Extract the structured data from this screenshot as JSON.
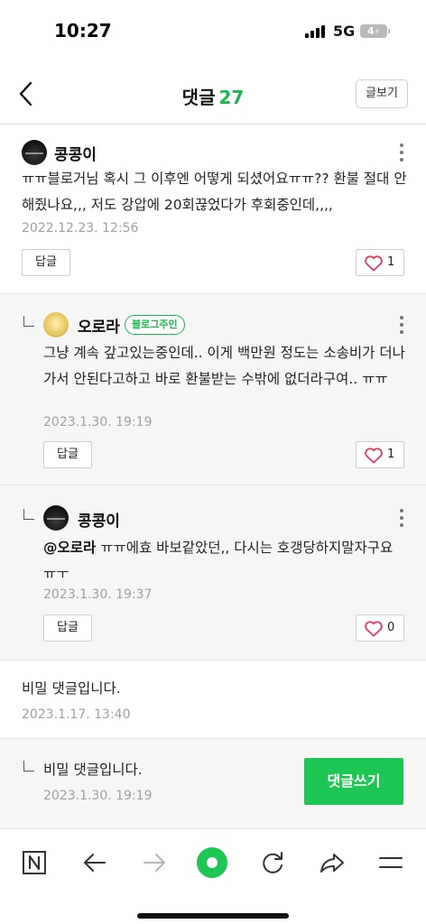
{
  "status_bar": {
    "time": "10:27",
    "network": "5G",
    "battery": "4"
  },
  "header": {
    "title": "댓글",
    "count": "27",
    "view_post_label": "글보기"
  },
  "comments": [
    {
      "nickname": "콩콩이",
      "text": "ㅠㅠ블로거님 혹시 그 이후엔 어떻게 되셨어요ㅠㅠ?? 환불 절대 안해줬나요,,, 저도 강압에 20회끊었다가 후회중인데,,,,",
      "date": "2022.12.23. 12:56",
      "reply_label": "답글",
      "likes": "1"
    },
    {
      "nickname": "오로라",
      "badge": "블로그주인",
      "text": "그냥 계속 갚고있는중인데.. 이게 백만원 정도는 소송비가 더나가서 안된다고하고 바로 환불받는 수밖에 없더라구여.. ㅠㅠ",
      "date": "2023.1.30. 19:19",
      "reply_label": "답글",
      "likes": "1"
    },
    {
      "nickname": "콩콩이",
      "mention": "@오로라",
      "text": " ㅠㅠ에효 바보같았던,, 다시는 호갱당하지말자구요 ㅠㅜ",
      "date": "2023.1.30. 19:37",
      "reply_label": "답글",
      "likes": "0"
    },
    {
      "text": "비밀 댓글입니다.",
      "date": "2023.1.17. 13:40"
    },
    {
      "text": "비밀 댓글입니다.",
      "date": "2023.1.30. 19:19"
    }
  ],
  "write_comment_label": "댓글쓰기",
  "colors": {
    "accent_green": "#1ec653",
    "like_heart": "#e8395f"
  },
  "bottom_bar": {
    "icons": [
      "naver-n-icon",
      "back-arrow-icon",
      "forward-arrow-icon",
      "home-circle-icon",
      "refresh-icon",
      "share-icon",
      "menu-icon"
    ]
  }
}
